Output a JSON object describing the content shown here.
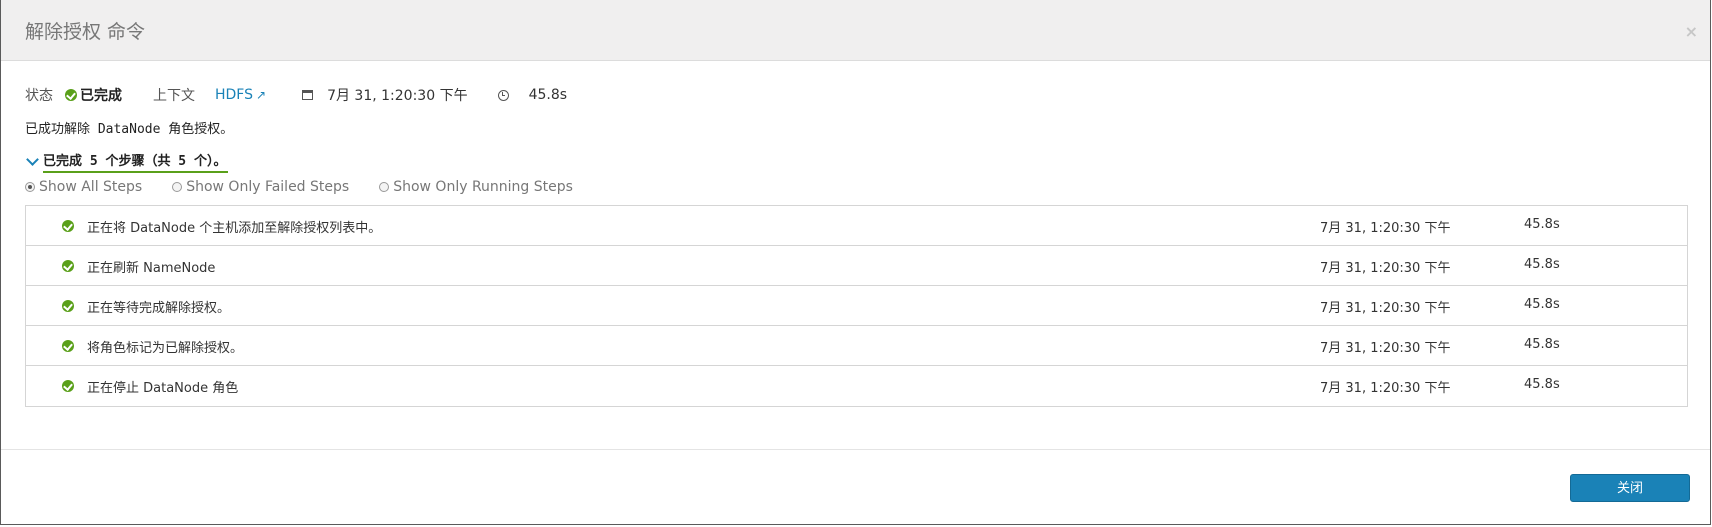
{
  "dialog": {
    "title": "解除授权 命令",
    "close_glyph": "×"
  },
  "meta": {
    "status_label": "状态",
    "status_value": "已完成",
    "context_label": "上下文",
    "context_link": "HDFS",
    "start_time": "7月 31, 1:20:30 下午",
    "duration": "45.8s"
  },
  "message": "已成功解除 DataNode 角色授权。",
  "steps_summary": "已完成 5 个步骤（共 5 个）。",
  "filters": {
    "all": "Show All Steps",
    "failed": "Show Only Failed Steps",
    "running": "Show Only Running Steps",
    "selected": "all"
  },
  "steps": [
    {
      "name": "正在将 DataNode 个主机添加至解除授权列表中。",
      "time": "7月 31, 1:20:30 下午",
      "duration": "45.8s"
    },
    {
      "name": "正在刷新 NameNode",
      "time": "7月 31, 1:20:30 下午",
      "duration": "45.8s"
    },
    {
      "name": "正在等待完成解除授权。",
      "time": "7月 31, 1:20:30 下午",
      "duration": "45.8s"
    },
    {
      "name": "将角色标记为已解除授权。",
      "time": "7月 31, 1:20:30 下午",
      "duration": "45.8s"
    },
    {
      "name": "正在停止 DataNode 角色",
      "time": "7月 31, 1:20:30 下午",
      "duration": "45.8s"
    }
  ],
  "footer": {
    "close_label": "关闭"
  },
  "colors": {
    "accent": "#1a82b7",
    "success": "#5aa01a"
  },
  "icons": {
    "status": "check-circle-icon",
    "external": "external-link-icon",
    "date": "calendar-icon",
    "duration": "clock-icon",
    "expand": "chevron-down-icon"
  }
}
